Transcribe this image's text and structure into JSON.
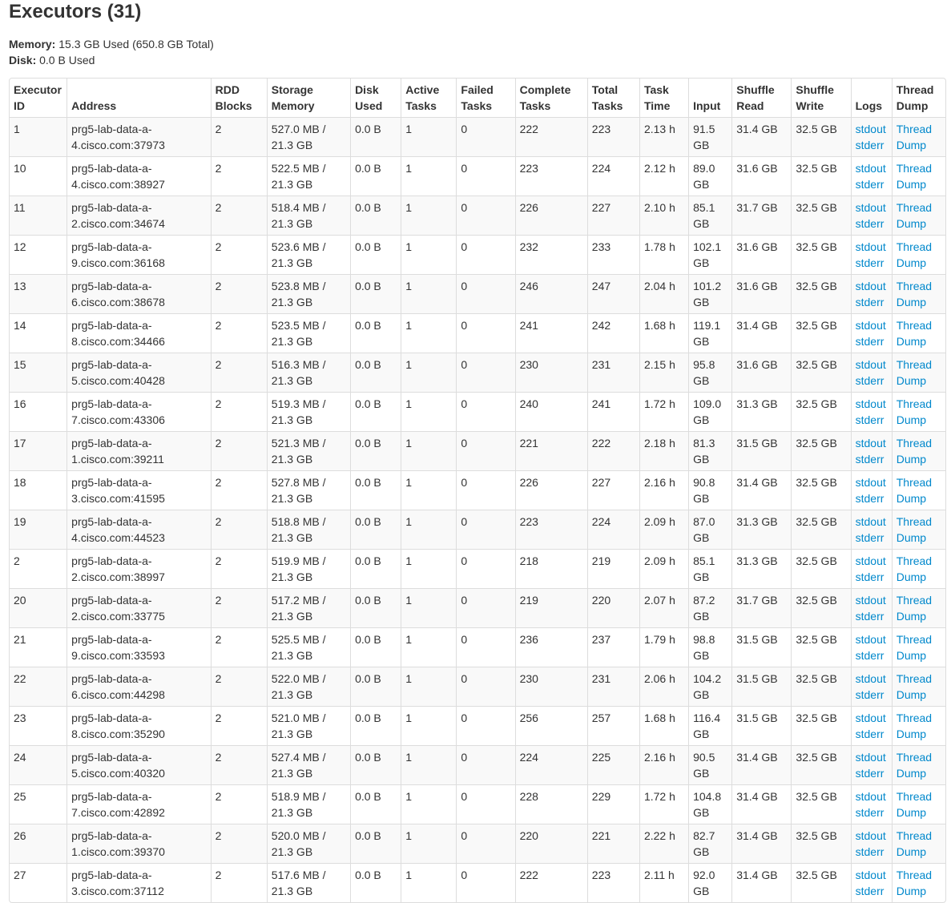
{
  "title": "Executors (31)",
  "summary": {
    "memory_label": "Memory:",
    "memory_value": "15.3 GB Used (650.8 GB Total)",
    "disk_label": "Disk:",
    "disk_value": "0.0 B Used"
  },
  "table": {
    "headers": {
      "executor_id": [
        "Executor",
        "ID"
      ],
      "address": [
        "",
        "Address"
      ],
      "rdd_blocks": [
        "RDD",
        "Blocks"
      ],
      "storage_memory": [
        "Storage",
        "Memory"
      ],
      "disk_used": [
        "Disk",
        "Used"
      ],
      "active_tasks": [
        "Active",
        "Tasks"
      ],
      "failed_tasks": [
        "Failed",
        "Tasks"
      ],
      "complete_tasks": [
        "Complete",
        "Tasks"
      ],
      "total_tasks": [
        "Total",
        "Tasks"
      ],
      "task_time": [
        "Task",
        "Time"
      ],
      "input": [
        "",
        "Input"
      ],
      "shuffle_read": [
        "Shuffle",
        "Read"
      ],
      "shuffle_write": [
        "Shuffle",
        "Write"
      ],
      "logs": [
        "",
        "Logs"
      ],
      "thread_dump": [
        "Thread",
        "Dump"
      ]
    },
    "rows": [
      {
        "id": "1",
        "addr1": "prg5-lab-data-a-",
        "addr2": "4.cisco.com:37973",
        "rdd": "2",
        "mem1": "527.0 MB /",
        "mem2": "21.3 GB",
        "disk": "0.0 B",
        "active": "1",
        "failed": "0",
        "complete": "222",
        "total": "223",
        "time": "2.13 h",
        "input1": "91.5",
        "input2": "GB",
        "sread": "31.4 GB",
        "swrite": "32.5 GB",
        "stdout": "stdout",
        "stderr": "stderr",
        "td1": "Thread",
        "td2": "Dump"
      },
      {
        "id": "10",
        "addr1": "prg5-lab-data-a-",
        "addr2": "4.cisco.com:38927",
        "rdd": "2",
        "mem1": "522.5 MB /",
        "mem2": "21.3 GB",
        "disk": "0.0 B",
        "active": "1",
        "failed": "0",
        "complete": "223",
        "total": "224",
        "time": "2.12 h",
        "input1": "89.0",
        "input2": "GB",
        "sread": "31.6 GB",
        "swrite": "32.5 GB",
        "stdout": "stdout",
        "stderr": "stderr",
        "td1": "Thread",
        "td2": "Dump"
      },
      {
        "id": "11",
        "addr1": "prg5-lab-data-a-",
        "addr2": "2.cisco.com:34674",
        "rdd": "2",
        "mem1": "518.4 MB /",
        "mem2": "21.3 GB",
        "disk": "0.0 B",
        "active": "1",
        "failed": "0",
        "complete": "226",
        "total": "227",
        "time": "2.10 h",
        "input1": "85.1",
        "input2": "GB",
        "sread": "31.7 GB",
        "swrite": "32.5 GB",
        "stdout": "stdout",
        "stderr": "stderr",
        "td1": "Thread",
        "td2": "Dump"
      },
      {
        "id": "12",
        "addr1": "prg5-lab-data-a-",
        "addr2": "9.cisco.com:36168",
        "rdd": "2",
        "mem1": "523.6 MB /",
        "mem2": "21.3 GB",
        "disk": "0.0 B",
        "active": "1",
        "failed": "0",
        "complete": "232",
        "total": "233",
        "time": "1.78 h",
        "input1": "102.1",
        "input2": "GB",
        "sread": "31.6 GB",
        "swrite": "32.5 GB",
        "stdout": "stdout",
        "stderr": "stderr",
        "td1": "Thread",
        "td2": "Dump"
      },
      {
        "id": "13",
        "addr1": "prg5-lab-data-a-",
        "addr2": "6.cisco.com:38678",
        "rdd": "2",
        "mem1": "523.8 MB /",
        "mem2": "21.3 GB",
        "disk": "0.0 B",
        "active": "1",
        "failed": "0",
        "complete": "246",
        "total": "247",
        "time": "2.04 h",
        "input1": "101.2",
        "input2": "GB",
        "sread": "31.6 GB",
        "swrite": "32.5 GB",
        "stdout": "stdout",
        "stderr": "stderr",
        "td1": "Thread",
        "td2": "Dump"
      },
      {
        "id": "14",
        "addr1": "prg5-lab-data-a-",
        "addr2": "8.cisco.com:34466",
        "rdd": "2",
        "mem1": "523.5 MB /",
        "mem2": "21.3 GB",
        "disk": "0.0 B",
        "active": "1",
        "failed": "0",
        "complete": "241",
        "total": "242",
        "time": "1.68 h",
        "input1": "119.1",
        "input2": "GB",
        "sread": "31.4 GB",
        "swrite": "32.5 GB",
        "stdout": "stdout",
        "stderr": "stderr",
        "td1": "Thread",
        "td2": "Dump"
      },
      {
        "id": "15",
        "addr1": "prg5-lab-data-a-",
        "addr2": "5.cisco.com:40428",
        "rdd": "2",
        "mem1": "516.3 MB /",
        "mem2": "21.3 GB",
        "disk": "0.0 B",
        "active": "1",
        "failed": "0",
        "complete": "230",
        "total": "231",
        "time": "2.15 h",
        "input1": "95.8",
        "input2": "GB",
        "sread": "31.6 GB",
        "swrite": "32.5 GB",
        "stdout": "stdout",
        "stderr": "stderr",
        "td1": "Thread",
        "td2": "Dump"
      },
      {
        "id": "16",
        "addr1": "prg5-lab-data-a-",
        "addr2": "7.cisco.com:43306",
        "rdd": "2",
        "mem1": "519.3 MB /",
        "mem2": "21.3 GB",
        "disk": "0.0 B",
        "active": "1",
        "failed": "0",
        "complete": "240",
        "total": "241",
        "time": "1.72 h",
        "input1": "109.0",
        "input2": "GB",
        "sread": "31.3 GB",
        "swrite": "32.5 GB",
        "stdout": "stdout",
        "stderr": "stderr",
        "td1": "Thread",
        "td2": "Dump"
      },
      {
        "id": "17",
        "addr1": "prg5-lab-data-a-",
        "addr2": "1.cisco.com:39211",
        "rdd": "2",
        "mem1": "521.3 MB /",
        "mem2": "21.3 GB",
        "disk": "0.0 B",
        "active": "1",
        "failed": "0",
        "complete": "221",
        "total": "222",
        "time": "2.18 h",
        "input1": "81.3",
        "input2": "GB",
        "sread": "31.5 GB",
        "swrite": "32.5 GB",
        "stdout": "stdout",
        "stderr": "stderr",
        "td1": "Thread",
        "td2": "Dump"
      },
      {
        "id": "18",
        "addr1": "prg5-lab-data-a-",
        "addr2": "3.cisco.com:41595",
        "rdd": "2",
        "mem1": "527.8 MB /",
        "mem2": "21.3 GB",
        "disk": "0.0 B",
        "active": "1",
        "failed": "0",
        "complete": "226",
        "total": "227",
        "time": "2.16 h",
        "input1": "90.8",
        "input2": "GB",
        "sread": "31.4 GB",
        "swrite": "32.5 GB",
        "stdout": "stdout",
        "stderr": "stderr",
        "td1": "Thread",
        "td2": "Dump"
      },
      {
        "id": "19",
        "addr1": "prg5-lab-data-a-",
        "addr2": "4.cisco.com:44523",
        "rdd": "2",
        "mem1": "518.8 MB /",
        "mem2": "21.3 GB",
        "disk": "0.0 B",
        "active": "1",
        "failed": "0",
        "complete": "223",
        "total": "224",
        "time": "2.09 h",
        "input1": "87.0",
        "input2": "GB",
        "sread": "31.3 GB",
        "swrite": "32.5 GB",
        "stdout": "stdout",
        "stderr": "stderr",
        "td1": "Thread",
        "td2": "Dump"
      },
      {
        "id": "2",
        "addr1": "prg5-lab-data-a-",
        "addr2": "2.cisco.com:38997",
        "rdd": "2",
        "mem1": "519.9 MB /",
        "mem2": "21.3 GB",
        "disk": "0.0 B",
        "active": "1",
        "failed": "0",
        "complete": "218",
        "total": "219",
        "time": "2.09 h",
        "input1": "85.1",
        "input2": "GB",
        "sread": "31.3 GB",
        "swrite": "32.5 GB",
        "stdout": "stdout",
        "stderr": "stderr",
        "td1": "Thread",
        "td2": "Dump"
      },
      {
        "id": "20",
        "addr1": "prg5-lab-data-a-",
        "addr2": "2.cisco.com:33775",
        "rdd": "2",
        "mem1": "517.2 MB /",
        "mem2": "21.3 GB",
        "disk": "0.0 B",
        "active": "1",
        "failed": "0",
        "complete": "219",
        "total": "220",
        "time": "2.07 h",
        "input1": "87.2",
        "input2": "GB",
        "sread": "31.7 GB",
        "swrite": "32.5 GB",
        "stdout": "stdout",
        "stderr": "stderr",
        "td1": "Thread",
        "td2": "Dump"
      },
      {
        "id": "21",
        "addr1": "prg5-lab-data-a-",
        "addr2": "9.cisco.com:33593",
        "rdd": "2",
        "mem1": "525.5 MB /",
        "mem2": "21.3 GB",
        "disk": "0.0 B",
        "active": "1",
        "failed": "0",
        "complete": "236",
        "total": "237",
        "time": "1.79 h",
        "input1": "98.8",
        "input2": "GB",
        "sread": "31.5 GB",
        "swrite": "32.5 GB",
        "stdout": "stdout",
        "stderr": "stderr",
        "td1": "Thread",
        "td2": "Dump"
      },
      {
        "id": "22",
        "addr1": "prg5-lab-data-a-",
        "addr2": "6.cisco.com:44298",
        "rdd": "2",
        "mem1": "522.0 MB /",
        "mem2": "21.3 GB",
        "disk": "0.0 B",
        "active": "1",
        "failed": "0",
        "complete": "230",
        "total": "231",
        "time": "2.06 h",
        "input1": "104.2",
        "input2": "GB",
        "sread": "31.5 GB",
        "swrite": "32.5 GB",
        "stdout": "stdout",
        "stderr": "stderr",
        "td1": "Thread",
        "td2": "Dump"
      },
      {
        "id": "23",
        "addr1": "prg5-lab-data-a-",
        "addr2": "8.cisco.com:35290",
        "rdd": "2",
        "mem1": "521.0 MB /",
        "mem2": "21.3 GB",
        "disk": "0.0 B",
        "active": "1",
        "failed": "0",
        "complete": "256",
        "total": "257",
        "time": "1.68 h",
        "input1": "116.4",
        "input2": "GB",
        "sread": "31.5 GB",
        "swrite": "32.5 GB",
        "stdout": "stdout",
        "stderr": "stderr",
        "td1": "Thread",
        "td2": "Dump"
      },
      {
        "id": "24",
        "addr1": "prg5-lab-data-a-",
        "addr2": "5.cisco.com:40320",
        "rdd": "2",
        "mem1": "527.4 MB /",
        "mem2": "21.3 GB",
        "disk": "0.0 B",
        "active": "1",
        "failed": "0",
        "complete": "224",
        "total": "225",
        "time": "2.16 h",
        "input1": "90.5",
        "input2": "GB",
        "sread": "31.4 GB",
        "swrite": "32.5 GB",
        "stdout": "stdout",
        "stderr": "stderr",
        "td1": "Thread",
        "td2": "Dump"
      },
      {
        "id": "25",
        "addr1": "prg5-lab-data-a-",
        "addr2": "7.cisco.com:42892",
        "rdd": "2",
        "mem1": "518.9 MB /",
        "mem2": "21.3 GB",
        "disk": "0.0 B",
        "active": "1",
        "failed": "0",
        "complete": "228",
        "total": "229",
        "time": "1.72 h",
        "input1": "104.8",
        "input2": "GB",
        "sread": "31.4 GB",
        "swrite": "32.5 GB",
        "stdout": "stdout",
        "stderr": "stderr",
        "td1": "Thread",
        "td2": "Dump"
      },
      {
        "id": "26",
        "addr1": "prg5-lab-data-a-",
        "addr2": "1.cisco.com:39370",
        "rdd": "2",
        "mem1": "520.0 MB /",
        "mem2": "21.3 GB",
        "disk": "0.0 B",
        "active": "1",
        "failed": "0",
        "complete": "220",
        "total": "221",
        "time": "2.22 h",
        "input1": "82.7",
        "input2": "GB",
        "sread": "31.4 GB",
        "swrite": "32.5 GB",
        "stdout": "stdout",
        "stderr": "stderr",
        "td1": "Thread",
        "td2": "Dump"
      },
      {
        "id": "27",
        "addr1": "prg5-lab-data-a-",
        "addr2": "3.cisco.com:37112",
        "rdd": "2",
        "mem1": "517.6 MB /",
        "mem2": "21.3 GB",
        "disk": "0.0 B",
        "active": "1",
        "failed": "0",
        "complete": "222",
        "total": "223",
        "time": "2.11 h",
        "input1": "92.0",
        "input2": "GB",
        "sread": "31.4 GB",
        "swrite": "32.5 GB",
        "stdout": "stdout",
        "stderr": "stderr",
        "td1": "Thread",
        "td2": "Dump"
      }
    ]
  },
  "colors": {
    "link": "#0088cc",
    "text": "#333333",
    "border": "#dddddd",
    "stripe": "#f9f9f9"
  }
}
